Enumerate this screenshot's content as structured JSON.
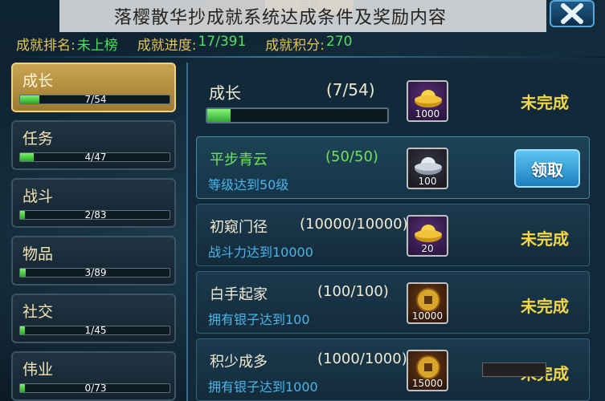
{
  "banner": {
    "title": "落樱散华抄成就系统达成条件及奖励内容",
    "tab_label": "成就"
  },
  "stats": {
    "rank_label": "成就排名:",
    "rank_value": "未上榜",
    "progress_label": "成就进度:",
    "progress_value": "17/391",
    "points_label": "成就积分:",
    "points_value": "270"
  },
  "categories": [
    {
      "name": "成长",
      "count": "7/54",
      "fraction": 0.13
    },
    {
      "name": "任务",
      "count": "4/47",
      "fraction": 0.09
    },
    {
      "name": "战斗",
      "count": "2/83",
      "fraction": 0.03
    },
    {
      "name": "物品",
      "count": "3/89",
      "fraction": 0.04
    },
    {
      "name": "社交",
      "count": "1/45",
      "fraction": 0.03
    },
    {
      "name": "伟业",
      "count": "0/73",
      "fraction": 0.0
    }
  ],
  "summary": {
    "name": "成长",
    "progress": "(7/54)",
    "fraction": 0.13,
    "reward_qty": "1000",
    "status": "未完成",
    "reward_icon": "gold-ingot-icon"
  },
  "achievements": [
    {
      "title": "平步青云",
      "progress": "(50/50)",
      "desc": "等级达到50级",
      "reward_qty": "100",
      "reward_icon": "silver-ingot-icon",
      "action": "领取"
    },
    {
      "title": "初窥门径",
      "progress": "(10000/10000)",
      "desc": "战斗力达到10000",
      "reward_qty": "20",
      "reward_icon": "gold-ingot-icon",
      "status": "未完成"
    },
    {
      "title": "白手起家",
      "progress": "(100/100)",
      "desc": "拥有银子达到100",
      "reward_qty": "10000",
      "reward_icon": "coin-icon",
      "status": "未完成"
    },
    {
      "title": "积少成多",
      "progress": "(1000/1000)",
      "desc": "拥有银子达到1000",
      "reward_qty": "15000",
      "reward_icon": "coin-icon",
      "status": "未完成"
    }
  ],
  "colors": {
    "accent_gold": "#e5c35a",
    "accent_green": "#4fe05c",
    "status_yellow": "#f3d84a",
    "desc_blue": "#4ab4ea"
  }
}
